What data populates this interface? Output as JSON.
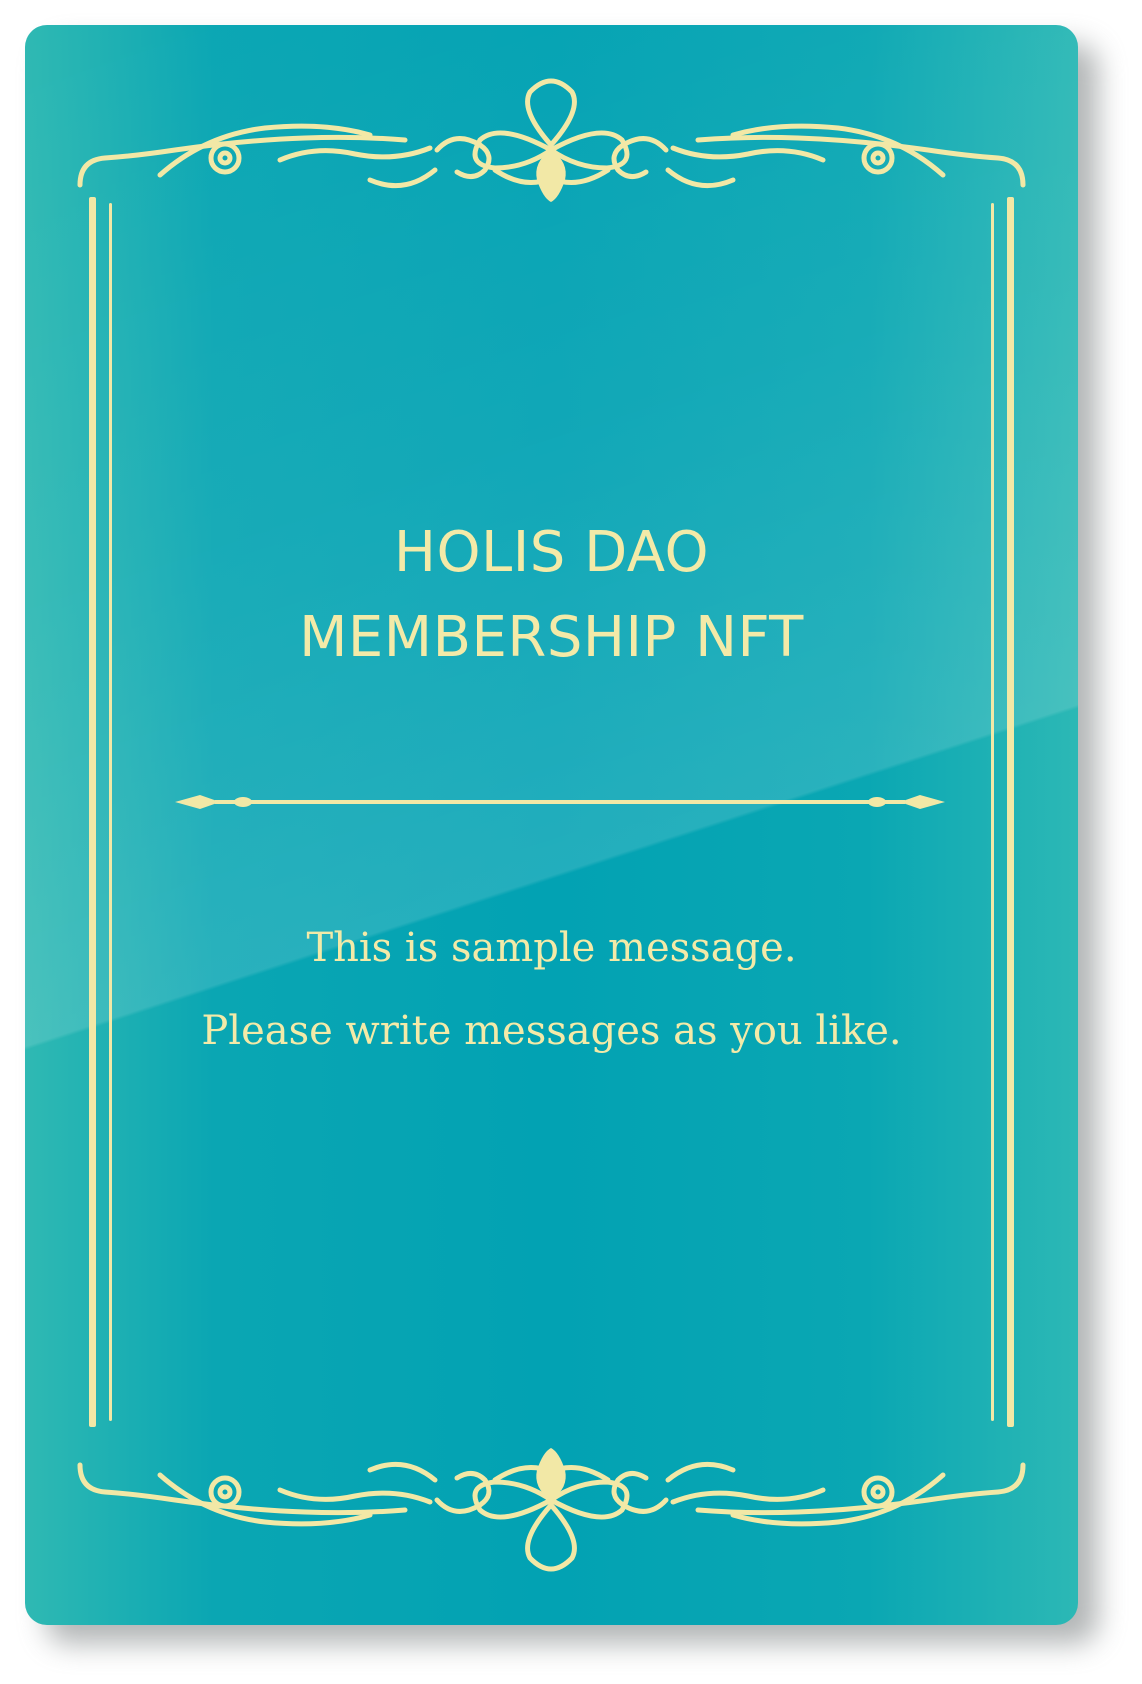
{
  "card": {
    "title_line1": "HOLIS DAO",
    "title_line2": "MEMBERSHIP NFT",
    "message_line1": "This is sample message.",
    "message_line2": "Please write messages as you like."
  },
  "colors": {
    "background_teal": "#02a2b3",
    "edge_teal": "#2fb9b3",
    "gold": "#f2e8a6"
  },
  "icons": [
    "top-flourish-ornament-icon",
    "bottom-flourish-ornament-icon",
    "divider-ornament-icon"
  ]
}
